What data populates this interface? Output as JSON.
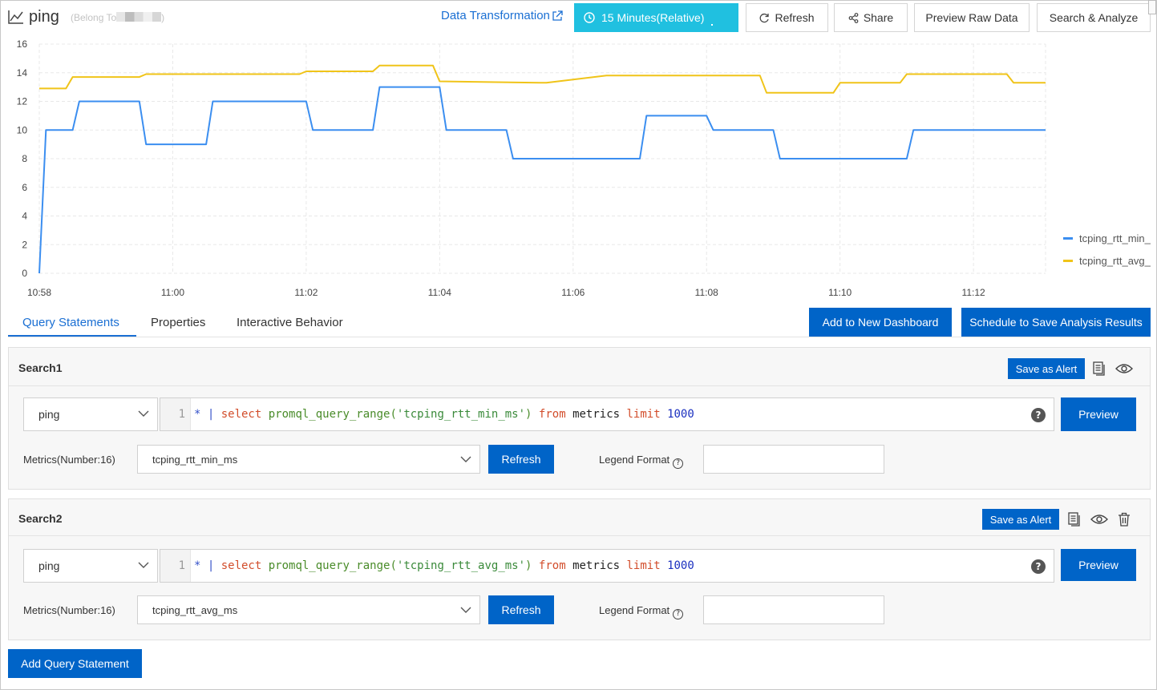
{
  "header": {
    "title": "ping",
    "belong_prefix": "(Belong To",
    "belong_suffix": ")",
    "data_transformation": "Data Transformation",
    "time_range": "15 Minutes(Relative)",
    "refresh": "Refresh",
    "share": "Share",
    "preview_raw_data": "Preview Raw Data",
    "search_analyze": "Search & Analyze"
  },
  "chart_data": {
    "type": "line",
    "ylim": [
      0,
      16
    ],
    "yticks": [
      "0",
      "2",
      "4",
      "6",
      "8",
      "10",
      "12",
      "14",
      "16"
    ],
    "xticks": [
      "10:58",
      "11:00",
      "11:02",
      "11:04",
      "11:06",
      "11:08",
      "11:10",
      "11:12"
    ],
    "x_range_minutes": [
      0,
      15.08
    ],
    "series": [
      {
        "name": "tcping_rtt_min_ms",
        "color": "#3b8ef0",
        "x": [
          0,
          0.1,
          0.5,
          0.6,
          1.5,
          1.6,
          2.5,
          2.6,
          4.0,
          4.1,
          5.0,
          5.1,
          6.0,
          6.1,
          7.0,
          7.1,
          8.0,
          8.1,
          9.0,
          9.1,
          10.0,
          10.1,
          11.0,
          11.1,
          12.0,
          12.1,
          13.0,
          13.1,
          15.08
        ],
        "values": [
          0,
          10,
          10,
          12,
          12,
          9,
          9,
          12,
          12,
          10,
          10,
          13,
          13,
          10,
          10,
          8,
          8,
          8,
          8,
          11,
          11,
          10,
          10,
          8,
          8,
          8,
          8,
          10,
          10
        ]
      },
      {
        "name": "tcping_rtt_avg_ms",
        "color": "#f0c419",
        "x": [
          0,
          0.4,
          0.5,
          1.5,
          1.6,
          3.9,
          4.0,
          5.0,
          5.1,
          5.9,
          6.0,
          7.5,
          7.6,
          8.5,
          8.6,
          10.8,
          10.9,
          11.9,
          12.0,
          12.9,
          13.0,
          14.5,
          14.6,
          15.08
        ],
        "values": [
          12.9,
          12.9,
          13.7,
          13.7,
          13.9,
          13.9,
          14.1,
          14.1,
          14.5,
          14.5,
          13.4,
          13.3,
          13.3,
          13.8,
          13.8,
          13.8,
          12.6,
          12.6,
          13.3,
          13.3,
          13.9,
          13.9,
          13.3,
          13.3
        ]
      }
    ],
    "legend": [
      "tcping_rtt_min_",
      "tcping_rtt_avg_"
    ],
    "legend_position": "right",
    "grid": true
  },
  "tabs": {
    "items": [
      "Query Statements",
      "Properties",
      "Interactive Behavior"
    ],
    "add_dashboard": "Add to New Dashboard",
    "schedule": "Schedule to Save Analysis Results"
  },
  "searches": [
    {
      "title": "Search1",
      "save_alert": "Save as Alert",
      "logstore": "ping",
      "line_no": "1",
      "q": {
        "star": "* ",
        "bar": "| ",
        "select": "select ",
        "fn": "promql_query_range(",
        "str": "'tcping_rtt_min_ms'",
        "close": ") ",
        "from": "from ",
        "table": "metrics ",
        "limit": "limit ",
        "num": "1000"
      },
      "preview": "Preview",
      "metrics_label": "Metrics(Number:16)",
      "metric": "tcping_rtt_min_ms",
      "refresh": "Refresh",
      "legend_format_label": "Legend Format",
      "legend_format_value": ""
    },
    {
      "title": "Search2",
      "save_alert": "Save as Alert",
      "logstore": "ping",
      "line_no": "1",
      "q": {
        "star": "* ",
        "bar": "| ",
        "select": "select ",
        "fn": "promql_query_range(",
        "str": "'tcping_rtt_avg_ms'",
        "close": ") ",
        "from": "from ",
        "table": "metrics ",
        "limit": "limit ",
        "num": "1000"
      },
      "preview": "Preview",
      "metrics_label": "Metrics(Number:16)",
      "metric": "tcping_rtt_avg_ms",
      "refresh": "Refresh",
      "legend_format_label": "Legend Format",
      "legend_format_value": ""
    }
  ],
  "add_query": "Add Query Statement"
}
